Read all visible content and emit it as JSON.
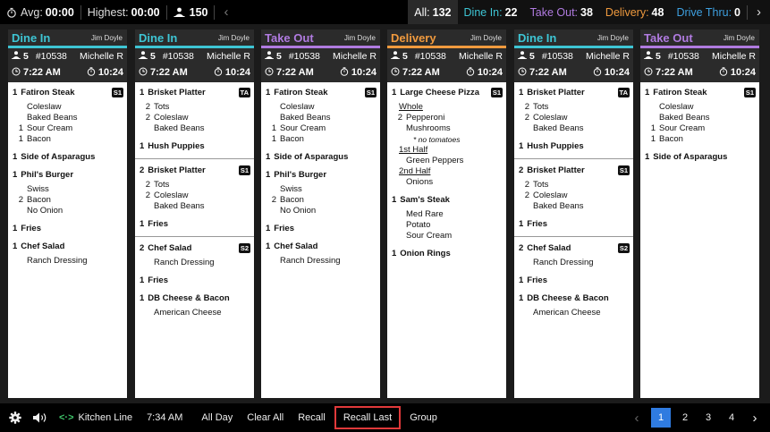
{
  "topbar": {
    "avg_label": "Avg:",
    "avg_value": "00:00",
    "highest_label": "Highest:",
    "highest_value": "00:00",
    "guests": "150",
    "filters": [
      {
        "label": "All:",
        "count": "132"
      },
      {
        "label": "Dine In:",
        "count": "22"
      },
      {
        "label": "Take Out:",
        "count": "38"
      },
      {
        "label": "Delivery:",
        "count": "48"
      },
      {
        "label": "Drive Thru:",
        "count": "0"
      }
    ]
  },
  "colors": {
    "dine_in": "#3ec5d4",
    "take_out": "#b07be0",
    "delivery": "#f09a3e",
    "drive_thru": "#3ea0e0",
    "highlight": "#e0393a",
    "pager_active": "#2f7be0"
  },
  "tickets": [
    {
      "type": "Dine In",
      "server": "Jim Doyle",
      "guests": "5",
      "order": "#10538",
      "waiter": "Michelle R",
      "time": "7:22 AM",
      "elapsed": "10:24",
      "groups": [
        {
          "items": [
            {
              "qty": "1",
              "name": "Fatiron Steak",
              "badge": "S1",
              "mods": [
                [
                  "",
                  "Coleslaw"
                ],
                [
                  "",
                  "Baked Beans"
                ],
                [
                  "1",
                  "Sour Cream"
                ],
                [
                  "1",
                  "Bacon"
                ]
              ]
            },
            {
              "qty": "1",
              "name": "Side of Asparagus",
              "badge": "",
              "mods": []
            },
            {
              "qty": "1",
              "name": "Phil's Burger",
              "badge": "",
              "mods": [
                [
                  "",
                  "Swiss"
                ],
                [
                  "2",
                  "Bacon"
                ],
                [
                  "",
                  "No Onion"
                ]
              ]
            },
            {
              "qty": "1",
              "name": "Fries",
              "badge": "",
              "mods": []
            },
            {
              "qty": "1",
              "name": "Chef Salad",
              "badge": "",
              "mods": [
                [
                  "",
                  "Ranch Dressing"
                ]
              ]
            }
          ]
        }
      ]
    },
    {
      "type": "Dine In",
      "server": "Jim Doyle",
      "guests": "5",
      "order": "#10538",
      "waiter": "Michelle R",
      "time": "7:22 AM",
      "elapsed": "10:24",
      "groups": [
        {
          "items": [
            {
              "qty": "1",
              "name": "Brisket Platter",
              "badge": "TA",
              "mods": [
                [
                  "2",
                  "Tots"
                ],
                [
                  "2",
                  "Coleslaw"
                ],
                [
                  "",
                  "Baked Beans"
                ]
              ]
            },
            {
              "qty": "1",
              "name": "Hush Puppies",
              "badge": "",
              "mods": []
            }
          ]
        },
        {
          "items": [
            {
              "qty": "2",
              "name": "Brisket Platter",
              "badge": "S1",
              "mods": [
                [
                  "2",
                  "Tots"
                ],
                [
                  "2",
                  "Coleslaw"
                ],
                [
                  "",
                  "Baked Beans"
                ]
              ]
            },
            {
              "qty": "1",
              "name": "Fries",
              "badge": "",
              "mods": []
            }
          ]
        },
        {
          "items": [
            {
              "qty": "2",
              "name": "Chef Salad",
              "badge": "S2",
              "mods": [
                [
                  "",
                  "Ranch Dressing"
                ]
              ]
            },
            {
              "qty": "1",
              "name": "Fries",
              "badge": "",
              "mods": []
            },
            {
              "qty": "1",
              "name": "DB Cheese & Bacon",
              "badge": "",
              "mods": [
                [
                  "",
                  "American Cheese"
                ]
              ]
            }
          ]
        }
      ]
    },
    {
      "type": "Take Out",
      "server": "Jim Doyle",
      "guests": "5",
      "order": "#10538",
      "waiter": "Michelle R",
      "time": "7:22 AM",
      "elapsed": "10:24",
      "groups": [
        {
          "items": [
            {
              "qty": "1",
              "name": "Fatiron Steak",
              "badge": "S1",
              "mods": [
                [
                  "",
                  "Coleslaw"
                ],
                [
                  "",
                  "Baked Beans"
                ],
                [
                  "1",
                  "Sour Cream"
                ],
                [
                  "1",
                  "Bacon"
                ]
              ]
            },
            {
              "qty": "1",
              "name": "Side of Asparagus",
              "badge": "",
              "mods": []
            },
            {
              "qty": "1",
              "name": "Phil's Burger",
              "badge": "",
              "mods": [
                [
                  "",
                  "Swiss"
                ],
                [
                  "2",
                  "Bacon"
                ],
                [
                  "",
                  "No Onion"
                ]
              ]
            },
            {
              "qty": "1",
              "name": "Fries",
              "badge": "",
              "mods": []
            },
            {
              "qty": "1",
              "name": "Chef Salad",
              "badge": "",
              "mods": [
                [
                  "",
                  "Ranch Dressing"
                ]
              ]
            }
          ]
        }
      ]
    },
    {
      "type": "Delivery",
      "server": "Jim Doyle",
      "guests": "5",
      "order": "#10538",
      "waiter": "Michelle R",
      "time": "7:22 AM",
      "elapsed": "10:24",
      "groups": [
        {
          "items": [
            {
              "qty": "1",
              "name": "Large Cheese Pizza",
              "badge": "S1",
              "mods": [
                [
                  "u",
                  "Whole"
                ],
                [
                  "2",
                  "Pepperoni"
                ],
                [
                  "",
                  "Mushrooms"
                ],
                [
                  "i",
                  "* no tomatoes"
                ],
                [
                  "u",
                  "1st Half"
                ],
                [
                  "",
                  "Green Peppers"
                ],
                [
                  "u",
                  "2nd Half"
                ],
                [
                  "",
                  "Onions"
                ]
              ]
            },
            {
              "qty": "1",
              "name": "Sam's Steak",
              "badge": "",
              "mods": [
                [
                  "",
                  "Med Rare"
                ],
                [
                  "",
                  "Potato"
                ],
                [
                  "",
                  "Sour Cream"
                ]
              ]
            },
            {
              "qty": "1",
              "name": "Onion Rings",
              "badge": "",
              "mods": []
            }
          ]
        }
      ]
    },
    {
      "type": "Dine In",
      "server": "Jim Doyle",
      "guests": "5",
      "order": "#10538",
      "waiter": "Michelle R",
      "time": "7:22 AM",
      "elapsed": "10:24",
      "groups": [
        {
          "items": [
            {
              "qty": "1",
              "name": "Brisket Platter",
              "badge": "TA",
              "mods": [
                [
                  "2",
                  "Tots"
                ],
                [
                  "2",
                  "Coleslaw"
                ],
                [
                  "",
                  "Baked Beans"
                ]
              ]
            },
            {
              "qty": "1",
              "name": "Hush Puppies",
              "badge": "",
              "mods": []
            }
          ]
        },
        {
          "items": [
            {
              "qty": "2",
              "name": "Brisket Platter",
              "badge": "S1",
              "mods": [
                [
                  "2",
                  "Tots"
                ],
                [
                  "2",
                  "Coleslaw"
                ],
                [
                  "",
                  "Baked Beans"
                ]
              ]
            },
            {
              "qty": "1",
              "name": "Fries",
              "badge": "",
              "mods": []
            }
          ]
        },
        {
          "items": [
            {
              "qty": "2",
              "name": "Chef Salad",
              "badge": "S2",
              "mods": [
                [
                  "",
                  "Ranch Dressing"
                ]
              ]
            },
            {
              "qty": "1",
              "name": "Fries",
              "badge": "",
              "mods": []
            },
            {
              "qty": "1",
              "name": "DB Cheese & Bacon",
              "badge": "",
              "mods": [
                [
                  "",
                  "American Cheese"
                ]
              ]
            }
          ]
        }
      ]
    },
    {
      "type": "Take Out",
      "server": "Jim Doyle",
      "guests": "5",
      "order": "#10538",
      "waiter": "Michelle R",
      "time": "7:22 AM",
      "elapsed": "10:24",
      "groups": [
        {
          "items": [
            {
              "qty": "1",
              "name": "Fatiron Steak",
              "badge": "S1",
              "mods": [
                [
                  "",
                  "Coleslaw"
                ],
                [
                  "",
                  "Baked Beans"
                ],
                [
                  "1",
                  "Sour Cream"
                ],
                [
                  "1",
                  "Bacon"
                ]
              ]
            },
            {
              "qty": "1",
              "name": "Side of Asparagus",
              "badge": "",
              "mods": []
            }
          ]
        }
      ]
    }
  ],
  "bottombar": {
    "station": "Kitchen Line",
    "clock": "7:34 AM",
    "buttons": [
      "All Day",
      "Clear All",
      "Recall",
      "Recall Last",
      "Group"
    ],
    "pages": [
      "1",
      "2",
      "3",
      "4"
    ],
    "active_page": "1"
  }
}
